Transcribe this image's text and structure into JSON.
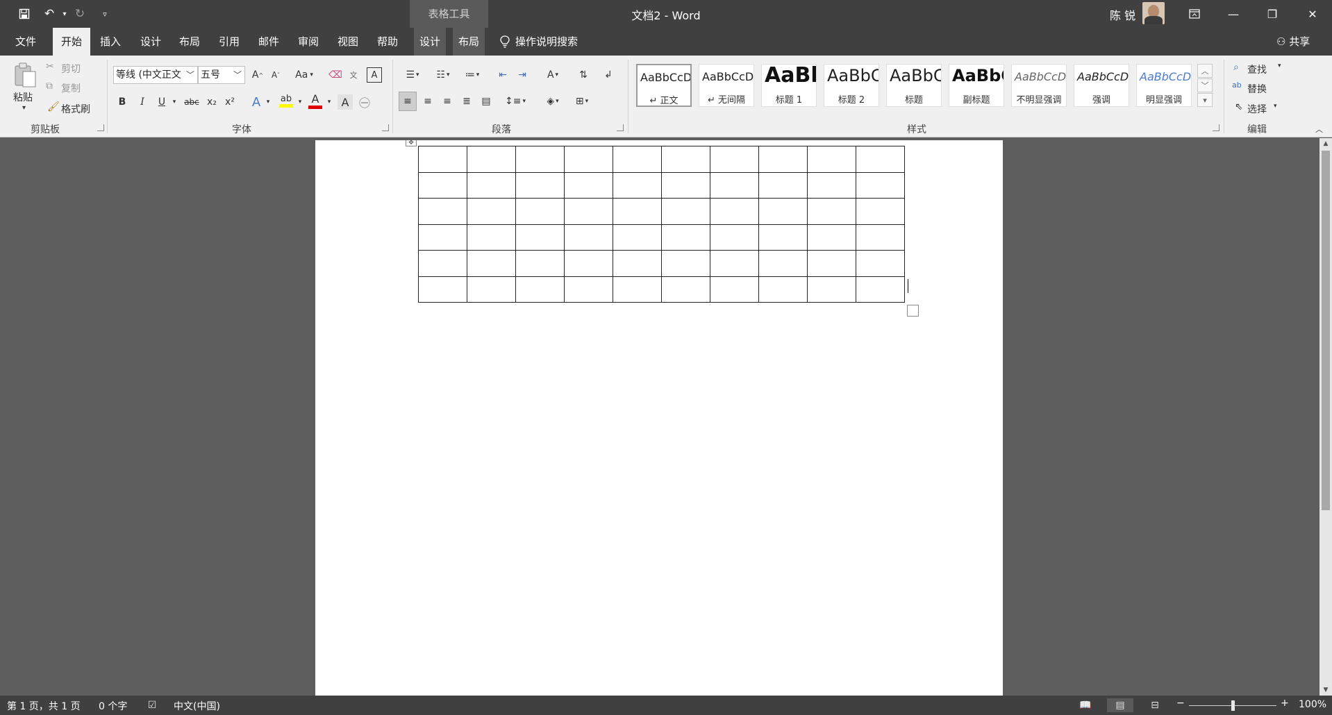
{
  "qat": {
    "save_icon": "save-icon",
    "undo_icon": "undo-icon",
    "redo_icon": "redo-icon",
    "customize_icon": "customize-qat-icon"
  },
  "title_bar": {
    "contextual_tab_group": "表格工具",
    "document_title": "文档2  -  Word",
    "user_name": "陈 锐"
  },
  "tabs": [
    "文件",
    "开始",
    "插入",
    "设计",
    "布局",
    "引用",
    "邮件",
    "审阅",
    "视图",
    "帮助",
    "设计",
    "布局"
  ],
  "active_tab_index": 1,
  "tell_me": "操作说明搜索",
  "share": "共享",
  "ribbon": {
    "clipboard": {
      "paste": "粘贴",
      "cut": "剪切",
      "copy": "复制",
      "format_painter": "格式刷",
      "label": "剪贴板"
    },
    "font": {
      "font_name": "等线 (中文正文",
      "font_size": "五号",
      "grow": "A",
      "shrink": "A",
      "change_case": "Aa",
      "bold": "B",
      "italic": "I",
      "underline": "U",
      "strike": "abc",
      "subscript": "x₂",
      "superscript": "x²",
      "label": "字体"
    },
    "paragraph": {
      "label": "段落"
    },
    "styles": {
      "label": "样式",
      "items": [
        {
          "sample": "AaBbCcDd",
          "name": "↵ 正文"
        },
        {
          "sample": "AaBbCcDd",
          "name": "↵ 无间隔"
        },
        {
          "sample": "AaBl",
          "name": "标题 1"
        },
        {
          "sample": "AaBbC",
          "name": "标题 2"
        },
        {
          "sample": "AaBbC",
          "name": "标题"
        },
        {
          "sample": "AaBbC",
          "name": "副标题"
        },
        {
          "sample": "AaBbCcDı",
          "name": "不明显强调"
        },
        {
          "sample": "AaBbCcDı",
          "name": "强调"
        },
        {
          "sample": "AaBbCcDı",
          "name": "明显强调"
        }
      ]
    },
    "editing": {
      "find": "查找",
      "replace": "替换",
      "select": "选择",
      "label": "编辑"
    }
  },
  "document": {
    "table": {
      "rows": 6,
      "cols": 10
    }
  },
  "status_bar": {
    "page": "第 1 页，共 1 页",
    "words": "0 个字",
    "language": "中文(中国)",
    "zoom": "100%",
    "zoom_level": 0.5
  }
}
